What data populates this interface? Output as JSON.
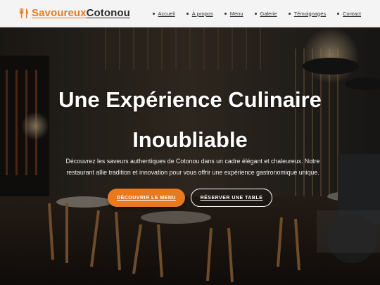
{
  "header": {
    "logo_part1": "Savoureux",
    "logo_part2": "Cotonou",
    "logo_icon": "utensils-icon",
    "nav": [
      {
        "label": "Accueil"
      },
      {
        "label": "À propos"
      },
      {
        "label": "Menu"
      },
      {
        "label": "Galerie"
      },
      {
        "label": "Témoignages"
      },
      {
        "label": "Contact"
      }
    ]
  },
  "hero": {
    "title_line1": "Une Expérience Culinaire",
    "title_line2": "Inoubliable",
    "description": "Découvrez les saveurs authentiques de Cotonou dans un cadre élégant et chaleureux. Notre restaurant allie tradition et innovation pour vous offrir une expérience gastronomique unique.",
    "primary_button": "DÉCOUVRIR LE MENU",
    "secondary_button": "RÉSERVER UNE TABLE"
  },
  "colors": {
    "accent": "#e8791f",
    "header_bg": "#f4f4f4",
    "text_dark": "#2d2d2d"
  }
}
